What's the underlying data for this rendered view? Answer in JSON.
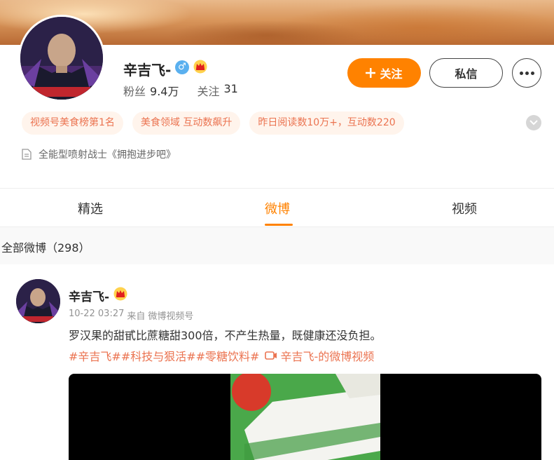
{
  "profile": {
    "name": "辛吉飞-",
    "gender_symbol": "♂",
    "followers_label": "粉丝",
    "followers_value": "9.4万",
    "following_label": "关注",
    "following_value": "31",
    "follow_button": "关注",
    "message_button": "私信",
    "tags": [
      "视频号美食榜第1名",
      "美食领域 互动数飙升",
      "昨日阅读数10万+，互动数220"
    ],
    "bio": "全能型喷射战士《拥抱进步吧》"
  },
  "tabs": [
    {
      "label": "精选",
      "active": false
    },
    {
      "label": "微博",
      "active": true
    },
    {
      "label": "视频",
      "active": false
    }
  ],
  "filter": {
    "label": "全部微博（298）"
  },
  "post": {
    "author": "辛吉飞-",
    "time": "10-22 03:27",
    "source_prefix": "来自",
    "source": "微博视频号",
    "text": "罗汉果的甜甙比蔗糖甜300倍，不产生热量，既健康还没负担。",
    "hashtags": "#辛吉飞##科技与狠活##零糖饮料#",
    "video_link": "辛吉飞-的微博视频"
  },
  "colors": {
    "accent": "#ff8200",
    "tag_text": "#eb7350",
    "tag_bg": "#fff4ec"
  },
  "icons": [
    "male-icon",
    "vip-crown-icon",
    "plus-icon",
    "more-icon",
    "chevron-down-icon",
    "document-icon",
    "video-link-icon"
  ]
}
